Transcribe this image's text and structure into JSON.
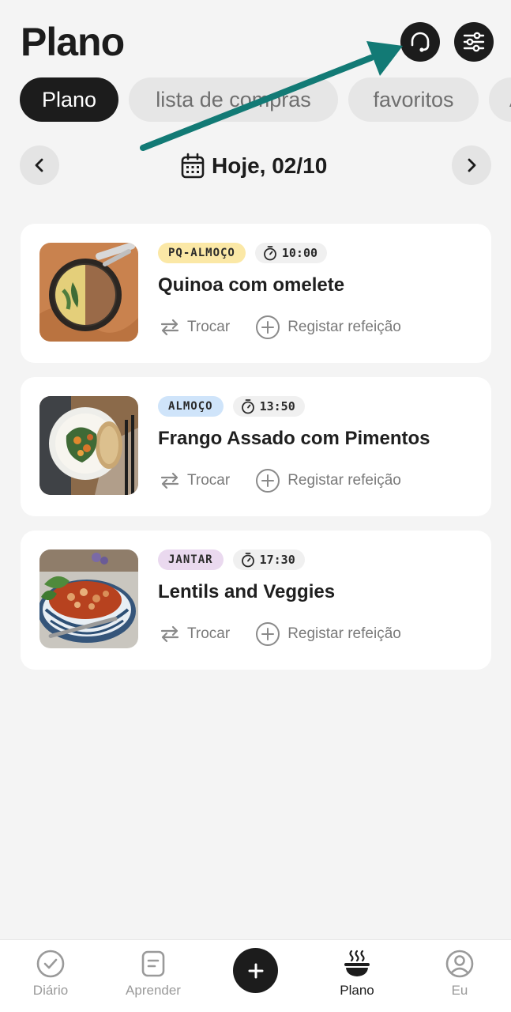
{
  "header": {
    "title": "Plano"
  },
  "tabs": [
    {
      "label": "Plano",
      "active": true
    },
    {
      "label": "lista de compras",
      "active": false
    },
    {
      "label": "favoritos",
      "active": false
    },
    {
      "label": "A",
      "active": false
    }
  ],
  "date_nav": {
    "label": "Hoje, 02/10"
  },
  "meals": [
    {
      "tag": "PQ-ALMOÇO",
      "tag_color": "#fbe8a6",
      "time": "10:00",
      "name": "Quinoa com omelete",
      "swap_label": "Trocar",
      "log_label": "Registar refeição"
    },
    {
      "tag": "ALMOÇO",
      "tag_color": "#cfe4fa",
      "time": "13:50",
      "name": "Frango Assado com Pimentos",
      "swap_label": "Trocar",
      "log_label": "Registar refeição"
    },
    {
      "tag": "JANTAR",
      "tag_color": "#ead9ef",
      "time": "17:30",
      "name": "Lentils and Veggies",
      "swap_label": "Trocar",
      "log_label": "Registar refeição"
    }
  ],
  "bottom_nav": {
    "items": [
      {
        "label": "Diário",
        "icon": "check-circle-icon",
        "active": false
      },
      {
        "label": "Aprender",
        "icon": "note-icon",
        "active": false
      },
      {
        "label": "Plano",
        "icon": "food-bowl-icon",
        "active": true
      },
      {
        "label": "Eu",
        "icon": "profile-icon",
        "active": false
      }
    ],
    "add_icon": "plus-icon"
  },
  "colors": {
    "dark": "#1c1c1c",
    "background": "#f4f4f4",
    "annotation_arrow": "#127a75"
  }
}
